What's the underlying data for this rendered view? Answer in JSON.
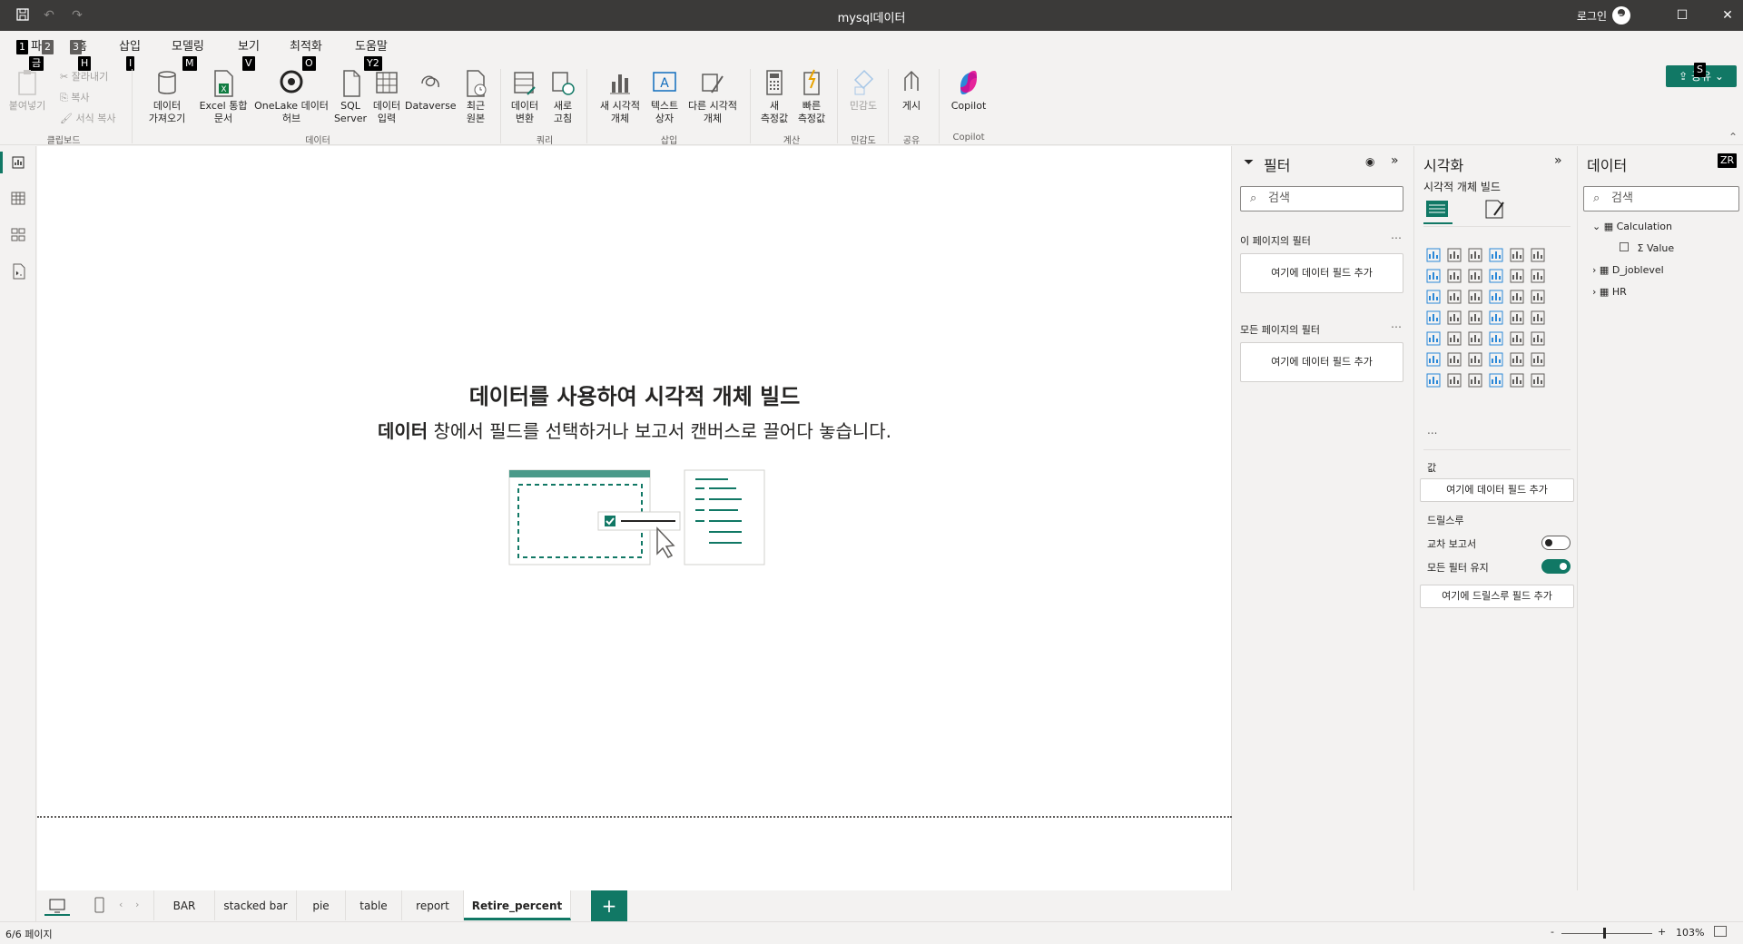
{
  "window": {
    "title": "mysql데이터",
    "signin": "로그인"
  },
  "tabs": [
    {
      "label": "파일",
      "key": "1"
    },
    {
      "label": "홈",
      "key": "H"
    },
    {
      "label": "삽입",
      "key": "I"
    },
    {
      "label": "모델링",
      "key": "M"
    },
    {
      "label": "보기",
      "key": "V"
    },
    {
      "label": "최적화",
      "key": "O"
    },
    {
      "label": "도움말",
      "key": "Y2"
    }
  ],
  "extra_keys": {
    "paste": "금",
    "tab2": "2",
    "tab3": "3",
    "share": "S",
    "data_pane": "ZR"
  },
  "share": {
    "label": "공유"
  },
  "ribbon": {
    "paste": "붙여넣기",
    "cut": "잘라내기",
    "copy": "복사",
    "format_copy": "서식 복사",
    "get_data": "데이터\n가져오기",
    "excel": "Excel 통합\n문서",
    "onelake": "OneLake 데이터\n허브",
    "sql": "SQL\nServer",
    "enter_data": "데이터\n입력",
    "dataverse": "Dataverse",
    "recent": "최근\n원본",
    "transform": "데이터\n변환",
    "refresh": "새로\n고침",
    "new_visual": "새 시각적\n개체",
    "textbox": "텍스트\n상자",
    "other_visual": "다른 시각적\n개체",
    "new_measure": "새\n측정값",
    "quick_measure": "빠른\n측정값",
    "sensitivity": "민감도",
    "publish": "게시",
    "copilot": "Copilot",
    "groups": {
      "clipboard": "클립보드",
      "data": "데이터",
      "query": "쿼리",
      "insert": "삽입",
      "calc": "계산",
      "sensitivity": "민감도",
      "share": "공유",
      "copilot": "Copilot"
    }
  },
  "canvas": {
    "title": "데이터를 사용하여 시각적 개체 빌드",
    "subtitle_bold": "데이터",
    "subtitle_rest": " 창에서 필드를 선택하거나 보고서 캔버스로 끌어다 놓습니다."
  },
  "pages": [
    "BAR",
    "stacked bar",
    "pie",
    "table",
    "report",
    "Retire_percent"
  ],
  "active_page": "Retire_percent",
  "status": {
    "page": "6/6 페이지",
    "zoom": "103%"
  },
  "filters": {
    "title": "필터",
    "search": "검색",
    "this_page": "이 페이지의 필터",
    "all_pages": "모든 페이지의 필터",
    "add_field": "여기에 데이터 필드 추가"
  },
  "viz": {
    "title": "시각화",
    "build": "시각적 개체 빌드",
    "values": "값",
    "add_field": "여기에 데이터 필드 추가",
    "drill": "드릴스루",
    "cross_report": "교차 보고서",
    "keep_filters": "모든 필터 유지",
    "add_drill": "여기에 드릴스루 필드 추가",
    "more": "...",
    "cross_report_on": false,
    "keep_filters_on": true
  },
  "data_pane": {
    "title": "데이터",
    "search": "검색",
    "tables": [
      {
        "name": "Calculation",
        "expanded": true,
        "fields": [
          "Value"
        ]
      },
      {
        "name": "D_joblevel",
        "expanded": false
      },
      {
        "name": "HR",
        "expanded": false
      }
    ]
  },
  "colors": {
    "accent": "#117865",
    "titlebar": "#3b3a39"
  }
}
